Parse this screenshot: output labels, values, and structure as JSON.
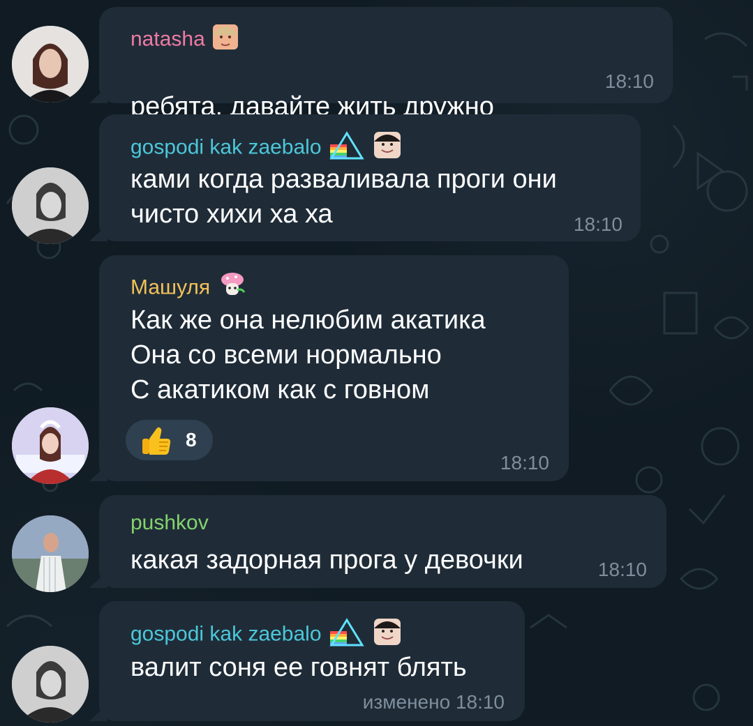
{
  "colors": {
    "background": "#101b23",
    "bubble": "#1f2c38",
    "timestamp": "#7f8e9c",
    "natasha_name": "#ef7aa3",
    "gospodi_name": "#4cc7d9",
    "mashulya_name": "#f3c15a",
    "pushkov_name": "#84d36b"
  },
  "messages": [
    {
      "sender": "natasha",
      "text": "ребята, давайте жить дружно",
      "time": "18:10",
      "sender_badge_icon": "woman-face-sticker-icon",
      "text_emoji_icon": "angel-emoji-icon",
      "avatar_icon": "natasha-avatar-icon"
    },
    {
      "sender": "gospodi kak zaebalo",
      "text": "ками когда разваливала проги они\nчисто хихи ха ха",
      "time": "18:10",
      "sender_badge_icon": "rainbow-flag-triangle-icon",
      "sender_sticker_icon": "girl-face-sticker-icon",
      "avatar_icon": "gospodi-avatar-icon"
    },
    {
      "sender": "Машуля",
      "text": "Как же она нелюбим акатика\nОна со всеми нормально\nС акатиком как с говном",
      "time": "18:10",
      "sender_badge_icon": "mushroom-sticker-icon",
      "reaction": {
        "icon": "thumbs-up-icon",
        "count": "8"
      },
      "avatar_icon": "mashulya-avatar-icon"
    },
    {
      "sender": "pushkov",
      "text": "какая задорная прога у девочки",
      "time": "18:10",
      "avatar_icon": "pushkov-avatar-icon"
    },
    {
      "sender": "gospodi kak zaebalo",
      "text": "валит соня ее говнят блять",
      "time": "изменено 18:10",
      "sender_badge_icon": "rainbow-flag-triangle-icon",
      "sender_sticker_icon": "girl-face-sticker-icon",
      "avatar_icon": "gospodi-avatar-icon"
    }
  ]
}
